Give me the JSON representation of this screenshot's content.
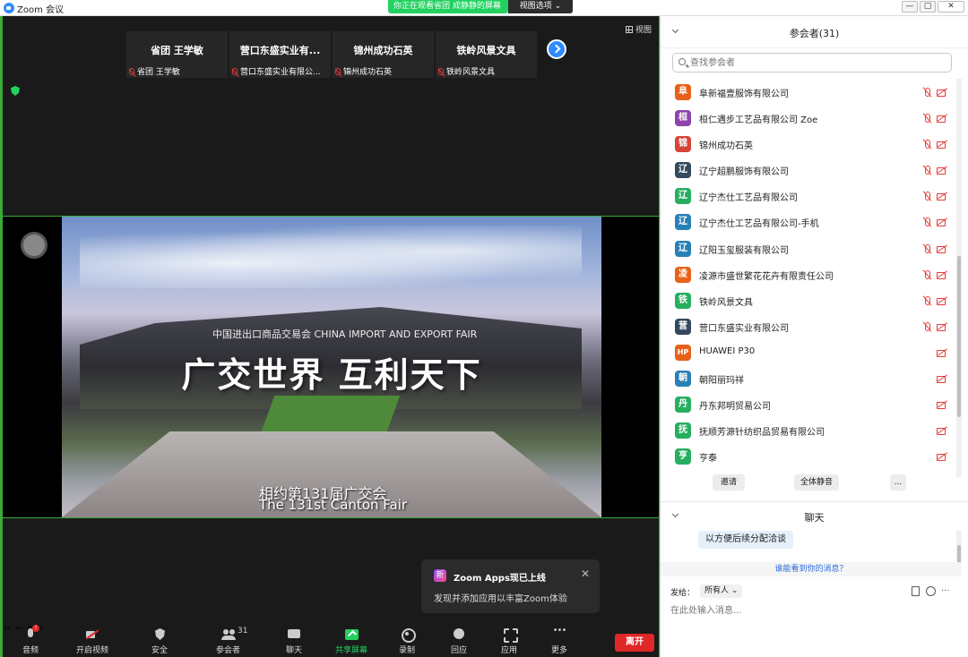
{
  "window": {
    "title": "Zoom 会议",
    "share_banner": "你正在观看省团 成静静的屏幕",
    "view_options": "视图选项 ⌄",
    "controls": [
      "—",
      "▢",
      "✕"
    ]
  },
  "meeting": {
    "view_label": "视图",
    "tiles": [
      {
        "name": "省团 王学敏",
        "label": "省团 王学敏"
      },
      {
        "name": "营口东盛实业有...",
        "label": "营口东盛实业有限公..."
      },
      {
        "name": "锦州成功石英",
        "label": "锦州成功石英"
      },
      {
        "name": "铁岭风景文具",
        "label": "铁岭风景文具"
      }
    ],
    "shared_screen": {
      "fair_logo": "中国进出口商品交易会 CHINA IMPORT AND EXPORT FAIR",
      "slogan": "广交世界  互利天下",
      "subtitle_cn": "相约第131届广交会",
      "subtitle_en": "The 131st Canton Fair"
    },
    "toast": {
      "badge": "新",
      "title": "Zoom Apps现已上线",
      "body": "发现并添加应用以丰富Zoom体验",
      "close": "✕"
    }
  },
  "toolbar": {
    "audio": "音频",
    "audio_badge": "!",
    "video": "开启视频",
    "security": "安全",
    "participants": "参会者",
    "participants_count": "31",
    "chat": "聊天",
    "share": "共享屏幕",
    "record": "录制",
    "reactions": "回应",
    "apps": "应用",
    "more": "更多",
    "leave": "离开"
  },
  "participants_panel": {
    "title": "参会者(31)",
    "search_placeholder": "查找参会者",
    "items": [
      {
        "initial": "阜",
        "name": "阜新福壹服饰有限公司",
        "color": "#e8611a",
        "muted": true
      },
      {
        "initial": "桓",
        "name": "桓仁遇步工艺品有限公司 Zoe",
        "color": "#8e44ad",
        "muted": true
      },
      {
        "initial": "锦",
        "name": "锦州成功石英",
        "color": "#d64535",
        "muted": true
      },
      {
        "initial": "辽",
        "name": "辽宁超鹏服饰有限公司",
        "color": "#34495e",
        "muted": true
      },
      {
        "initial": "辽",
        "name": "辽宁杰仕工艺品有限公司",
        "color": "#27ae60",
        "muted": true
      },
      {
        "initial": "辽",
        "name": "辽宁杰仕工艺品有限公司-手机",
        "color": "#2980b9",
        "muted": true
      },
      {
        "initial": "辽",
        "name": "辽阳玉玺服装有限公司",
        "color": "#2980b9",
        "muted": true
      },
      {
        "initial": "凌",
        "name": "凌源市盛世繁花花卉有限责任公司",
        "color": "#e8611a",
        "muted": true
      },
      {
        "initial": "铁",
        "name": "铁岭风景文具",
        "color": "#27ae60",
        "muted": true
      },
      {
        "initial": "营",
        "name": "营口东盛实业有限公司",
        "color": "#34495e",
        "muted": true
      },
      {
        "initial": "HP",
        "name": "HUAWEI P30",
        "color": "#e8611a",
        "muted": false
      },
      {
        "initial": "朝",
        "name": "朝阳丽玛祥",
        "color": "#2980b9",
        "muted": false
      },
      {
        "initial": "丹",
        "name": "丹东邦明贸易公司",
        "color": "#27ae60",
        "muted": false
      },
      {
        "initial": "抚",
        "name": "抚顺芳源针纺织品贸易有限公司",
        "color": "#27ae60",
        "muted": false
      },
      {
        "initial": "亨",
        "name": "亨泰",
        "color": "#27ae60",
        "muted": false
      }
    ],
    "invite": "邀请",
    "mute_all": "全体静音",
    "more": "..."
  },
  "chat_panel": {
    "title": "聊天",
    "message": "以方便后续分配洽谈",
    "who_can_see": "谁能看到你的消息？",
    "send_to_label": "发给：",
    "send_to_value": "所有人 ⌄",
    "more": "...",
    "input_placeholder": "在此处输入消息..."
  }
}
